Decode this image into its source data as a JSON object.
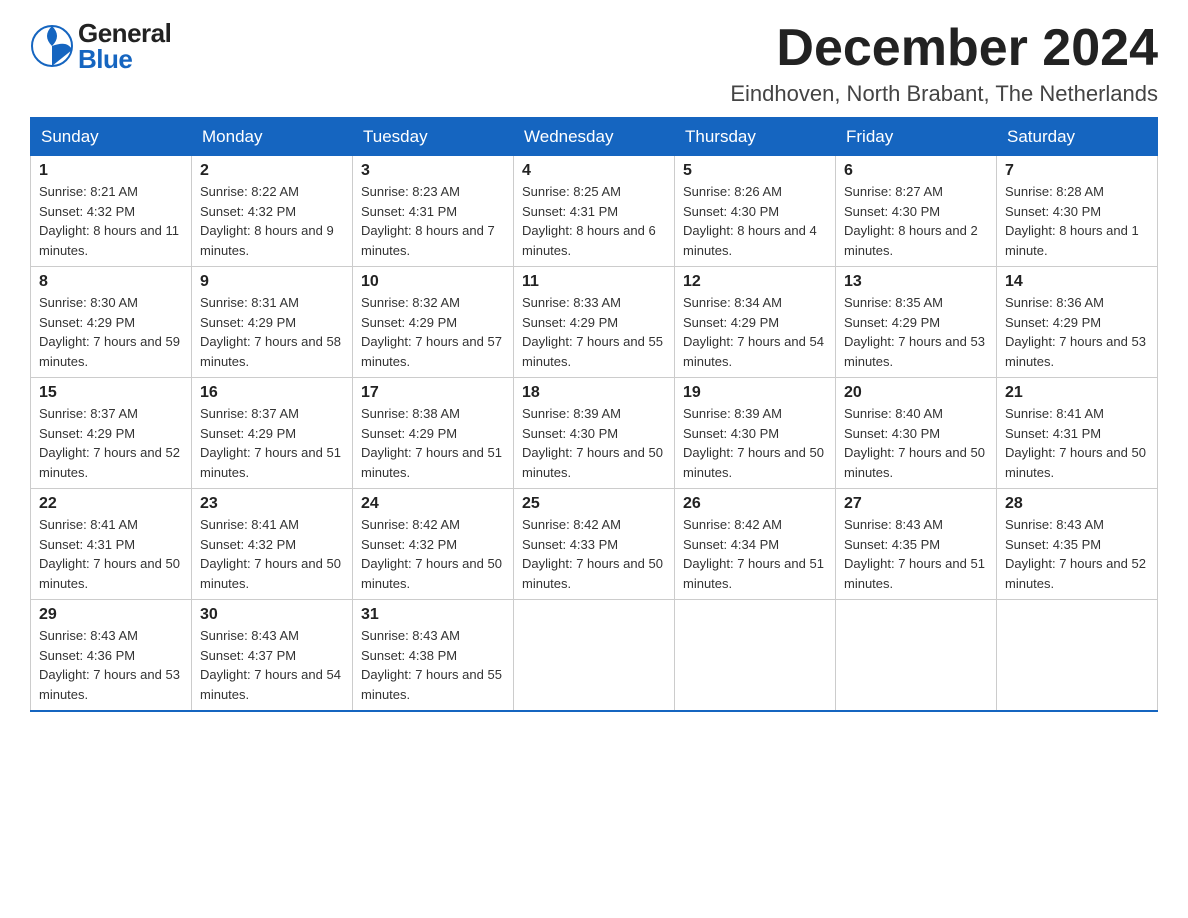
{
  "header": {
    "logo_general": "General",
    "logo_blue": "Blue",
    "month_title": "December 2024",
    "location": "Eindhoven, North Brabant, The Netherlands"
  },
  "days_of_week": [
    "Sunday",
    "Monday",
    "Tuesday",
    "Wednesday",
    "Thursday",
    "Friday",
    "Saturday"
  ],
  "weeks": [
    [
      {
        "day": "1",
        "sunrise": "8:21 AM",
        "sunset": "4:32 PM",
        "daylight": "8 hours and 11 minutes."
      },
      {
        "day": "2",
        "sunrise": "8:22 AM",
        "sunset": "4:32 PM",
        "daylight": "8 hours and 9 minutes."
      },
      {
        "day": "3",
        "sunrise": "8:23 AM",
        "sunset": "4:31 PM",
        "daylight": "8 hours and 7 minutes."
      },
      {
        "day": "4",
        "sunrise": "8:25 AM",
        "sunset": "4:31 PM",
        "daylight": "8 hours and 6 minutes."
      },
      {
        "day": "5",
        "sunrise": "8:26 AM",
        "sunset": "4:30 PM",
        "daylight": "8 hours and 4 minutes."
      },
      {
        "day": "6",
        "sunrise": "8:27 AM",
        "sunset": "4:30 PM",
        "daylight": "8 hours and 2 minutes."
      },
      {
        "day": "7",
        "sunrise": "8:28 AM",
        "sunset": "4:30 PM",
        "daylight": "8 hours and 1 minute."
      }
    ],
    [
      {
        "day": "8",
        "sunrise": "8:30 AM",
        "sunset": "4:29 PM",
        "daylight": "7 hours and 59 minutes."
      },
      {
        "day": "9",
        "sunrise": "8:31 AM",
        "sunset": "4:29 PM",
        "daylight": "7 hours and 58 minutes."
      },
      {
        "day": "10",
        "sunrise": "8:32 AM",
        "sunset": "4:29 PM",
        "daylight": "7 hours and 57 minutes."
      },
      {
        "day": "11",
        "sunrise": "8:33 AM",
        "sunset": "4:29 PM",
        "daylight": "7 hours and 55 minutes."
      },
      {
        "day": "12",
        "sunrise": "8:34 AM",
        "sunset": "4:29 PM",
        "daylight": "7 hours and 54 minutes."
      },
      {
        "day": "13",
        "sunrise": "8:35 AM",
        "sunset": "4:29 PM",
        "daylight": "7 hours and 53 minutes."
      },
      {
        "day": "14",
        "sunrise": "8:36 AM",
        "sunset": "4:29 PM",
        "daylight": "7 hours and 53 minutes."
      }
    ],
    [
      {
        "day": "15",
        "sunrise": "8:37 AM",
        "sunset": "4:29 PM",
        "daylight": "7 hours and 52 minutes."
      },
      {
        "day": "16",
        "sunrise": "8:37 AM",
        "sunset": "4:29 PM",
        "daylight": "7 hours and 51 minutes."
      },
      {
        "day": "17",
        "sunrise": "8:38 AM",
        "sunset": "4:29 PM",
        "daylight": "7 hours and 51 minutes."
      },
      {
        "day": "18",
        "sunrise": "8:39 AM",
        "sunset": "4:30 PM",
        "daylight": "7 hours and 50 minutes."
      },
      {
        "day": "19",
        "sunrise": "8:39 AM",
        "sunset": "4:30 PM",
        "daylight": "7 hours and 50 minutes."
      },
      {
        "day": "20",
        "sunrise": "8:40 AM",
        "sunset": "4:30 PM",
        "daylight": "7 hours and 50 minutes."
      },
      {
        "day": "21",
        "sunrise": "8:41 AM",
        "sunset": "4:31 PM",
        "daylight": "7 hours and 50 minutes."
      }
    ],
    [
      {
        "day": "22",
        "sunrise": "8:41 AM",
        "sunset": "4:31 PM",
        "daylight": "7 hours and 50 minutes."
      },
      {
        "day": "23",
        "sunrise": "8:41 AM",
        "sunset": "4:32 PM",
        "daylight": "7 hours and 50 minutes."
      },
      {
        "day": "24",
        "sunrise": "8:42 AM",
        "sunset": "4:32 PM",
        "daylight": "7 hours and 50 minutes."
      },
      {
        "day": "25",
        "sunrise": "8:42 AM",
        "sunset": "4:33 PM",
        "daylight": "7 hours and 50 minutes."
      },
      {
        "day": "26",
        "sunrise": "8:42 AM",
        "sunset": "4:34 PM",
        "daylight": "7 hours and 51 minutes."
      },
      {
        "day": "27",
        "sunrise": "8:43 AM",
        "sunset": "4:35 PM",
        "daylight": "7 hours and 51 minutes."
      },
      {
        "day": "28",
        "sunrise": "8:43 AM",
        "sunset": "4:35 PM",
        "daylight": "7 hours and 52 minutes."
      }
    ],
    [
      {
        "day": "29",
        "sunrise": "8:43 AM",
        "sunset": "4:36 PM",
        "daylight": "7 hours and 53 minutes."
      },
      {
        "day": "30",
        "sunrise": "8:43 AM",
        "sunset": "4:37 PM",
        "daylight": "7 hours and 54 minutes."
      },
      {
        "day": "31",
        "sunrise": "8:43 AM",
        "sunset": "4:38 PM",
        "daylight": "7 hours and 55 minutes."
      },
      null,
      null,
      null,
      null
    ]
  ],
  "labels": {
    "sunrise": "Sunrise:",
    "sunset": "Sunset:",
    "daylight": "Daylight:"
  }
}
